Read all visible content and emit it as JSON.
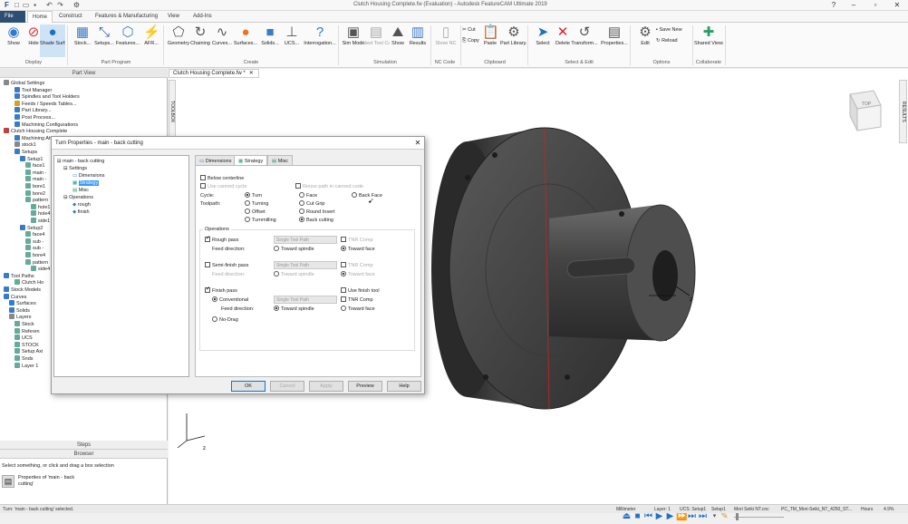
{
  "window": {
    "title": "Clutch Housing Complete.fw (Evaluation) - Autodesk FeatureCAM Ultimate 2019"
  },
  "ribbon_tabs": [
    "File",
    "Home",
    "Construct",
    "Features & Manufacturing",
    "View",
    "Add-Ins"
  ],
  "ribbon": {
    "display": {
      "label": "Display",
      "buttons": [
        "Show",
        "Hide",
        "Shade Surfaces"
      ]
    },
    "part_program": {
      "label": "Part Program",
      "buttons": [
        "Stock...",
        "Setups...",
        "Features...",
        "AFR..."
      ]
    },
    "create": {
      "label": "Create",
      "buttons": [
        "Geometry",
        "Chaining",
        "Curves...",
        "Surfaces...",
        "Solids...",
        "UCS...",
        "Interrogation..."
      ]
    },
    "simulation": {
      "label": "Simulation",
      "buttons": [
        "Sim Mode",
        "Next Tool Cuts",
        "Show",
        "Results"
      ]
    },
    "nc_code": {
      "label": "NC Code",
      "buttons": [
        "Show NC"
      ]
    },
    "clipboard": {
      "label": "Clipboard",
      "buttons": [
        "Cut",
        "Copy",
        "Paste",
        "Part Library..."
      ]
    },
    "select_edit": {
      "label": "Select & Edit",
      "buttons": [
        "Select",
        "Delete",
        "Transform...",
        "Properties..."
      ]
    },
    "options": {
      "label": "Options",
      "buttons": [
        "Edit",
        "Save New",
        "Reload"
      ]
    },
    "collaborate": {
      "label": "Collaborate",
      "buttons": [
        "Shared Views"
      ]
    }
  },
  "part_view": {
    "header": "Part View",
    "items": [
      "Global Settings",
      "Tool Manager",
      "Spindles and Tool Holders",
      "Feeds / Speeds Tables...",
      "Part Library...",
      "Post Process...",
      "Machining Configurations",
      "Clutch Housing Complete",
      "Machining Attributes",
      "stock1",
      "Setups",
      "Setup1",
      "face1",
      "main -",
      "main -",
      "bore1",
      "bore2",
      "pattern",
      "hole1",
      "hole4",
      "side1",
      "Setup2",
      "face4",
      "sub -",
      "sub -",
      "bore4",
      "pattern",
      "side4",
      "Tool Paths",
      "Clutch Ho",
      "Stock Models",
      "Curves",
      "Surfaces",
      "Solids",
      "Layers",
      "Stock",
      "Referen",
      "UCS",
      "STOCK",
      "Setup Axi",
      "Snds",
      "Layer 1"
    ]
  },
  "lp_bottom": {
    "steps": "Steps",
    "browser": "Browser"
  },
  "status_hint": "Select something, or click and drag a box selection",
  "properties_hint": "Properties of 'main - back cutting'",
  "doc_tab": "Clutch Housing Complete.fw *",
  "vtab_left": "TOOLBOX",
  "vtab_right": "RESULTS",
  "viewcube_label": "TOP",
  "dialog": {
    "title": "Turn Properties - main - back cutting",
    "tree": [
      "main - back cutting",
      "Settings",
      "Dimensions",
      "Strategy",
      "Misc",
      "Operations",
      "rough",
      "finish"
    ],
    "tabs": [
      "Dimensions",
      "Strategy",
      "Misc"
    ],
    "below_centerline": "Below centerline",
    "use_canned_cycle": "Use canned cycle",
    "reuse_path": "Reuse path in canned code",
    "cycle_label": "Cycle:",
    "cycle_options": [
      "Turn",
      "Face",
      "Back Face"
    ],
    "toolpath_label": "Toolpath:",
    "toolpath_options": [
      "Turning",
      "Cut Grip",
      "Offset",
      "Round Insert",
      "Turnmilling",
      "Back cutting"
    ],
    "operations_label": "Operations",
    "rough_pass": "Rough pass",
    "semi_finish_pass": "Semi-finish pass",
    "finish_pass": "Finish pass",
    "single_tool_path": "Single Tool Path",
    "feed_direction": "Feed direction:",
    "toward_spindle": "Toward spindle",
    "toward_face": "Toward face",
    "tnr_comp": "TNR Comp",
    "use_finish_tool": "Use finish tool",
    "conventional": "Conventional",
    "no_drag": "No-Drag",
    "buttons": {
      "ok": "OK",
      "cancel": "Cancel",
      "apply": "Apply",
      "preview": "Preview",
      "help": "Help"
    }
  },
  "bottom_status": {
    "left": "Turn: 'main - back cutting' selected.",
    "units": "Millimeter",
    "layer": "Layer: 1",
    "ucs": "UCS: Setup1",
    "setup": "Setup1",
    "post": "Mori Seiki NT.cnc",
    "machine": "PC_TM_Mori-Seiki_NT_4250_ST...",
    "time": "Hours",
    "zoom": "4.9%"
  }
}
